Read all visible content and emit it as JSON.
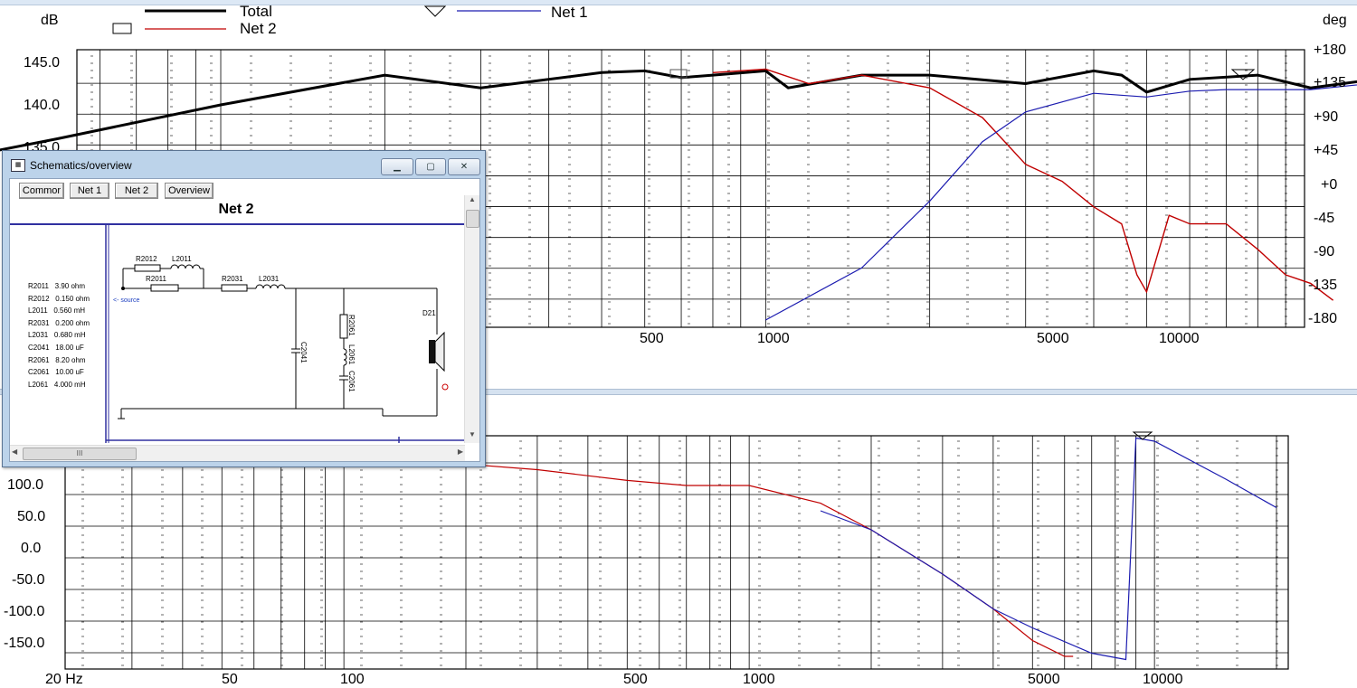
{
  "legend": {
    "total": "Total",
    "net2": "Net 2",
    "net1": "Net 1"
  },
  "top_chart": {
    "left_unit": "dB",
    "right_unit": "deg",
    "left_ticks": [
      "145.0",
      "140.0",
      "135.0"
    ],
    "right_ticks": [
      "+180",
      "+135",
      "+90",
      "+45",
      "+0",
      "-45",
      "-90",
      "-135",
      "-180"
    ],
    "x_ticks": [
      "500",
      "1000",
      "5000",
      "10000"
    ]
  },
  "bottom_chart": {
    "y_ticks": [
      "100.0",
      "50.0",
      "0.0",
      "-50.0",
      "-100.0",
      "-150.0"
    ],
    "x_ticks": [
      "20 Hz",
      "50",
      "100",
      "500",
      "1000",
      "5000",
      "10000"
    ]
  },
  "window": {
    "title": "Schematics/overview",
    "tabs": [
      "Commor",
      "Net 1",
      "Net 2",
      "Overview"
    ],
    "heading": "Net 2",
    "scroll_grip": "III",
    "components": [
      "R2011   3.90 ohm",
      "R2012   0.150 ohm",
      "L2011   0.560 mH",
      "R2031   0.200 ohm",
      "L2031   0.680 mH",
      "C2041   18.00 uF",
      "R2061   8.20 ohm",
      "C2061   10.00 uF",
      "L2061   4.000 mH"
    ],
    "schematic_labels": {
      "r2012": "R2012",
      "l2011": "L2011",
      "r2011": "R2011",
      "r2031": "R2031",
      "l2031": "L2031",
      "source": "<- source",
      "c2041": "C2041",
      "r2061": "R2061",
      "l2061": "L2061",
      "c2061": "C2061",
      "d21": "D21"
    }
  },
  "colors": {
    "total": "#000000",
    "net2": "#c00000",
    "net1": "#1c1cb0",
    "grid": "#000000",
    "window_frame": "#bcd3ea"
  },
  "chart_data": [
    {
      "type": "line",
      "xscale": "log",
      "x_range": [
        20,
        20000
      ],
      "y_left_label": "dB",
      "y_right_label": "deg",
      "series": [
        {
          "name": "Total",
          "x": [
            20,
            50,
            100,
            200,
            300,
            500,
            600,
            700,
            800,
            1000,
            1100,
            1500,
            2000,
            3000,
            4000,
            4500,
            5000,
            6000,
            8000,
            10000,
            15000,
            20000
          ],
          "y": [
            131,
            136,
            140,
            143.5,
            142,
            143.8,
            144,
            143.2,
            143.5,
            144,
            142,
            143.5,
            143.5,
            142.5,
            144,
            143.5,
            141.5,
            143,
            143.5,
            142,
            143.5,
            142
          ]
        },
        {
          "name": "Net 2",
          "x": [
            800,
            1000,
            1200,
            1500,
            2000,
            2500,
            3000,
            3500,
            4000,
            4500,
            4800,
            5000,
            5500,
            6000,
            7000,
            8000,
            9000,
            10000,
            11000
          ],
          "y": [
            143.8,
            144.2,
            142.5,
            143.5,
            142,
            138.5,
            133,
            131,
            128,
            126,
            120,
            118,
            127,
            126,
            126,
            123,
            120,
            119,
            117
          ]
        },
        {
          "name": "Net 1",
          "x": [
            1000,
            1500,
            2000,
            2500,
            3000,
            4000,
            5000,
            6000,
            7000,
            8000,
            10000,
            15000
          ],
          "y": [
            -180,
            -110,
            -20,
            60,
            100,
            125,
            120,
            128,
            130,
            130,
            130,
            143
          ]
        }
      ]
    },
    {
      "type": "line",
      "xscale": "log",
      "x_range": [
        20,
        20000
      ],
      "y_range": [
        -175,
        150
      ],
      "series": [
        {
          "name": "Net 2",
          "x": [
            150,
            300,
            500,
            700,
            800,
            1000,
            1500,
            2000,
            3000,
            4000,
            5000,
            6000,
            6300
          ],
          "y": [
            140,
            125,
            108,
            100,
            100,
            100,
            72,
            30,
            -40,
            -95,
            -145,
            -170,
            -170
          ]
        },
        {
          "name": "Net 1",
          "x": [
            1500,
            2000,
            3000,
            4000,
            5000,
            7000,
            8500,
            9000,
            10000,
            15000,
            20000
          ],
          "y": [
            60,
            30,
            -40,
            -95,
            -125,
            -165,
            -175,
            175,
            170,
            110,
            65
          ]
        }
      ]
    }
  ]
}
